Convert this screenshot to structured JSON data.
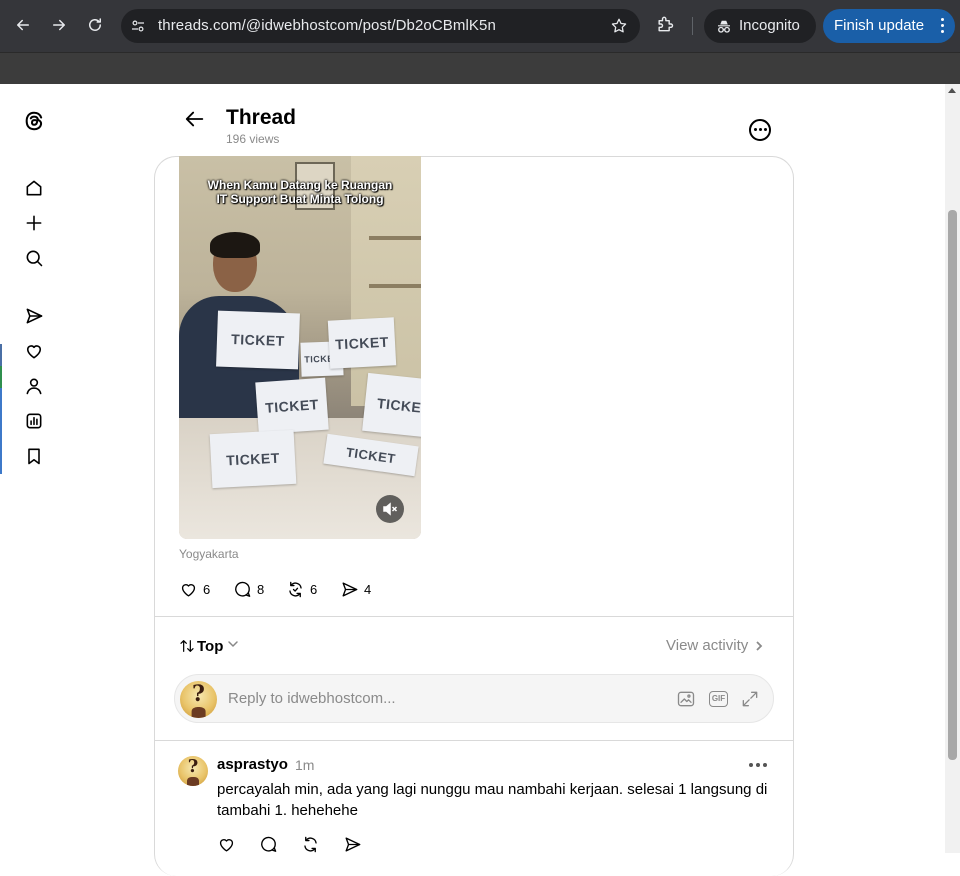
{
  "browser": {
    "url": "threads.com/@idwebhostcom/post/Db2oCBmlK5n",
    "incognito_label": "Incognito",
    "update_button": "Finish update",
    "icons": [
      "back-arrow-icon",
      "forward-arrow-icon",
      "reload-icon",
      "site-info-icon",
      "bookmark-star-icon",
      "extensions-icon",
      "incognito-icon",
      "menu-dots-icon"
    ]
  },
  "sidebar": {
    "items": [
      {
        "name": "threads-logo",
        "icon": "threads-logo-icon"
      },
      {
        "name": "home",
        "icon": "home-icon"
      },
      {
        "name": "create",
        "icon": "plus-icon"
      },
      {
        "name": "search",
        "icon": "search-icon"
      },
      {
        "name": "messages",
        "icon": "send-icon"
      },
      {
        "name": "activity",
        "icon": "heart-icon"
      },
      {
        "name": "profile",
        "icon": "person-icon"
      },
      {
        "name": "insights",
        "icon": "insights-icon"
      },
      {
        "name": "saved",
        "icon": "bookmark-icon"
      }
    ]
  },
  "header": {
    "title": "Thread",
    "views": "196 views"
  },
  "post": {
    "video_caption_line1": "When Kamu Datang ke Ruangan",
    "video_caption_line2": "IT Support Buat Minta Tolong",
    "ticket_label": "TICKET",
    "location": "Yogyakarta",
    "likes": "6",
    "comments": "8",
    "reposts": "6",
    "shares": "4"
  },
  "replies_section": {
    "sort_label": "Top",
    "view_activity": "View activity",
    "reply_placeholder": "Reply to idwebhostcom...",
    "gif_label": "GIF"
  },
  "comments": [
    {
      "username": "asprastyo",
      "time": "1m",
      "text": "percayalah min, ada yang lagi nunggu mau nambahi kerjaan. selesai 1 langsung di tambahi 1. hehehehe"
    }
  ],
  "colors": {
    "chrome_bg": "#35363a",
    "omnibox_bg": "#202124",
    "update_button": "#1a5fa8",
    "secondary_text": "#8a8a8a",
    "divider": "#d9d9d9"
  }
}
